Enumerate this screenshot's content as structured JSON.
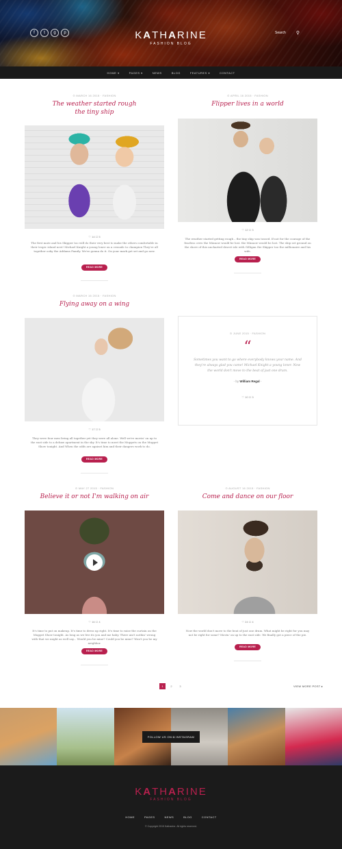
{
  "header": {
    "social": [
      "f",
      "t",
      "g",
      "p"
    ],
    "logo_pre": "K",
    "logo_a1": "A",
    "logo_mid": "TH",
    "logo_a2": "A",
    "logo_post": "RINE",
    "tagline": "FASHION BLOG",
    "search_placeholder": "Search"
  },
  "nav": [
    "HOME ▾",
    "PAGES ▾",
    "NEWS",
    "BLOG",
    "FEATURES ▾",
    "CONTACT"
  ],
  "posts": [
    {
      "meta": "⊙ MARCH 16 2015 · FASHION",
      "title_line1": "The weather started rough",
      "title_line2": "the tiny ship",
      "stats": "♡ 14   ☐ 5",
      "excerpt": "The first mate and his Skipper too will do their very best to make the others comfortable in their tropic island nest! Michael Knight a young loner on a crusade to champion They're all together ooky the Addams Family. We're gonna do it. On your mark get set and go now.",
      "button": "READ MORE"
    },
    {
      "meta": "⊙ APRIL 16 2015 · FASHION",
      "title_line1": "Flipper lives in a world",
      "title_line2": "",
      "stats": "♡ 12   ☐ 3",
      "excerpt": "The weather started getting rough – the tiny ship was tossed. If not for the courage of the fearless crew the Minnow would be lost. the Minnow would be lost. The ship set ground on the shore of this uncharted desert isle with Gilligan the Skipper too the millionaire and his wife.",
      "button": "READ MORE"
    },
    {
      "meta": "⊙ MARCH 16 2015 · FASHION",
      "title_line1": "Flying away on a wing",
      "title_line2": "",
      "stats": "♡ 17   ☐ 5",
      "excerpt": "They were four men living all together yet they were all alone. Well we're movin' on up to the east side to a deluxe apartment in the sky. It's time to meet the Muppets on the Muppet Show tonight. And When the odds are against him and their dangers work to do.",
      "button": "READ MORE"
    },
    {
      "meta": "⊙ MAY 27 2015 · FASHION",
      "title_line1": "Believe it or not I'm walking on air",
      "title_line2": "",
      "stats": "♡ 16   ☐ 4",
      "excerpt": "It's time to put on makeup. It's time to dress up right. It's time to raise the curtain on the Muppet Show tonight. As long as we live its you and me baby. There ain't nothin' wrong with that we might as well say... Would you be mine? Could you be mine? Won't you be my neighbor.",
      "button": "READ MORE"
    },
    {
      "meta": "⊙ AUGUST 16 2015 · FASHION",
      "title_line1": "Come and dance on our floor",
      "title_line2": "",
      "stats": "♡ 24   ☐ 4",
      "excerpt": "Now the world don't move to the beat of just one drum. What might be right for you may not be right for some? Movin' on up to the east side. We finally got a piece of the pie.",
      "button": "READ MORE"
    }
  ],
  "quote": {
    "meta": "⊙ JUNE 2015 · FASHION",
    "text": "Sometimes you want to go where everybody knows your name. And they're always glad you came! Michael Knight a young loner. Now the world don't move to the beat of just one drum.",
    "by_pre": "- by",
    "author": "William Regal",
    "by_post": "-",
    "stats": "♡ 10   ☐ 3"
  },
  "pagination": {
    "pages": [
      "1",
      "2",
      "3"
    ],
    "older": "VIEW MORE POST  ▸"
  },
  "instagram": {
    "follow": "FOLLOW US ON ◘ INSTAGRAM"
  },
  "footer": {
    "logo_pre": "K",
    "logo_a1": "A",
    "logo_mid": "TH",
    "logo_a2": "A",
    "logo_post": "RINE",
    "tagline": "FASHION BLOG",
    "nav": [
      "HOME",
      "PAGES",
      "NEWS",
      "BLOG",
      "CONTACT"
    ],
    "copyright": "© Copyright 2015 Katharine. All rights reserved."
  },
  "colors": {
    "accent": "#b8204e",
    "dark": "#1a1a1a"
  }
}
